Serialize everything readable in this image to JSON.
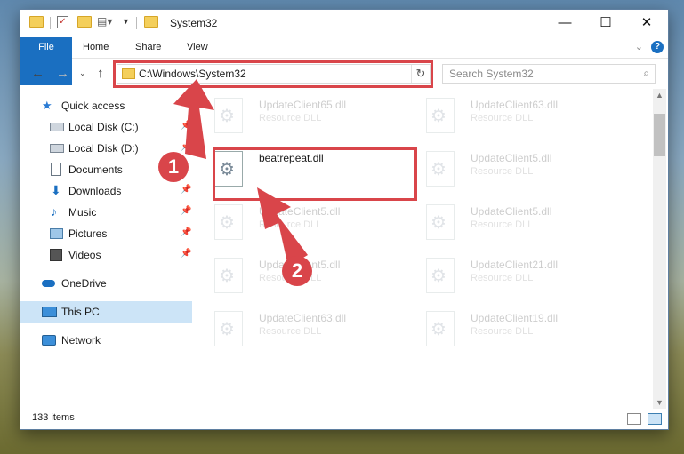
{
  "window": {
    "title": "System32",
    "controls": {
      "minimize": "—",
      "maximize": "☐",
      "close": "✕"
    }
  },
  "ribbon": {
    "tabs": [
      "File",
      "Home",
      "Share",
      "View"
    ],
    "help": "?"
  },
  "address": {
    "path": "C:\\Windows\\System32"
  },
  "search": {
    "placeholder": "Search System32"
  },
  "nav": {
    "items": [
      {
        "label": "Quick access",
        "icon": "star-icon"
      },
      {
        "label": "Local Disk (C:)",
        "icon": "drive-icon"
      },
      {
        "label": "Local Disk (D:)",
        "icon": "drive-icon"
      },
      {
        "label": "Documents",
        "icon": "documents-icon"
      },
      {
        "label": "Downloads",
        "icon": "download-icon"
      },
      {
        "label": "Music",
        "icon": "music-icon"
      },
      {
        "label": "Pictures",
        "icon": "pictures-icon"
      },
      {
        "label": "Videos",
        "icon": "videos-icon"
      },
      {
        "label": "OneDrive",
        "icon": "cloud-icon"
      },
      {
        "label": "This PC",
        "icon": "computer-icon"
      },
      {
        "label": "Network",
        "icon": "network-icon"
      }
    ]
  },
  "files": [
    {
      "name": "UpdateClient65.dll",
      "desc": "Resource DLL"
    },
    {
      "name": "UpdateClient63.dll",
      "desc": "Resource DLL"
    },
    {
      "name": "beatrepeat.dll",
      "desc": ""
    },
    {
      "name": "UpdateClient5.dll",
      "desc": "Resource DLL"
    },
    {
      "name": "UpdateClient5.dll",
      "desc": "Resource DLL"
    },
    {
      "name": "UpdateClient5.dll",
      "desc": "Resource DLL"
    },
    {
      "name": "UpdateClient5.dll",
      "desc": "Resource DLL"
    },
    {
      "name": "UpdateClient21.dll",
      "desc": "Resource DLL"
    },
    {
      "name": "UpdateClient63.dll",
      "desc": "Resource DLL"
    },
    {
      "name": "UpdateClient19.dll",
      "desc": "Resource DLL"
    }
  ],
  "status": {
    "count": "133 items"
  },
  "annotations": {
    "step1": "1",
    "step2": "2"
  },
  "colors": {
    "accent": "#1a6fc1",
    "highlight": "#d9454a",
    "selected": "#cce4f7"
  }
}
